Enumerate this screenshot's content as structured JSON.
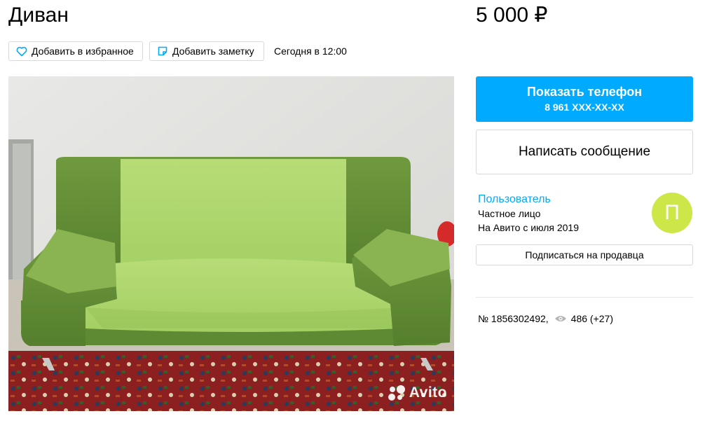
{
  "item": {
    "title": "Диван",
    "price": "5 000 ₽"
  },
  "actions": {
    "favorite_label": "Добавить в избранное",
    "note_label": "Добавить заметку",
    "posted": "Сегодня в 12:00"
  },
  "photo": {
    "watermark": "Avito"
  },
  "contact": {
    "show_phone_label": "Показать телефон",
    "phone_masked": "8 961 XXX-XX-XX",
    "message_label": "Написать сообщение"
  },
  "seller": {
    "name": "Пользователь",
    "type": "Частное лицо",
    "since": "На Авито с июля 2019",
    "avatar_letter": "П",
    "avatar_color": "#cde648",
    "subscribe_label": "Подписаться на продавца"
  },
  "stats": {
    "id": "№ 1856302492,",
    "views": "486 (+27)"
  },
  "colors": {
    "accent": "#00aaff"
  }
}
